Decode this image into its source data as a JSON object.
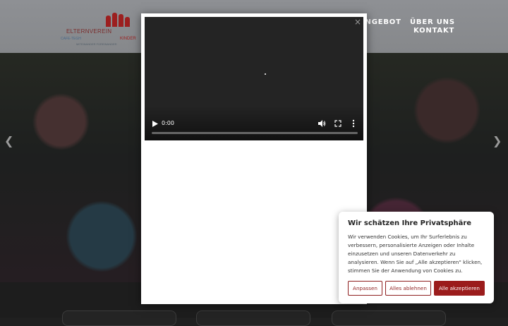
{
  "header": {
    "logo": {
      "name": "ELTERNVEREIN",
      "line2": "CAFE-TEGH",
      "kinder": "KINDER",
      "tagline": "MITEINANDER FÜREINANDER"
    },
    "nav": [
      {
        "label": "ANGEBOT"
      },
      {
        "label": "ÜBER UNS"
      },
      {
        "label": "KONTAKT"
      }
    ]
  },
  "video": {
    "time": "0:00",
    "progress": 0,
    "close_glyph": "×"
  },
  "cookie": {
    "title": "Wir schätzen Ihre Privatsphäre",
    "text": "Wir verwenden Cookies, um Ihr Surferlebnis zu verbessern, personalisierte Anzeigen oder Inhalte einzusetzen und unseren Datenverkehr zu analysieren. Wenn Sie auf „Alle akzeptieren\" klicken, stimmen Sie der Anwendung von Cookies zu.",
    "buttons": {
      "customize": "Anpassen",
      "reject": "Alles ablehnen",
      "accept": "Alle akzeptieren"
    }
  },
  "colors": {
    "brand_red": "#9b1c1c",
    "header_gray": "#8e9094",
    "video_bg": "#242424"
  },
  "icons": [
    "play-icon",
    "volume-icon",
    "fullscreen-icon",
    "more-vert-icon",
    "close-icon",
    "chevron-left-icon",
    "chevron-right-icon"
  ]
}
